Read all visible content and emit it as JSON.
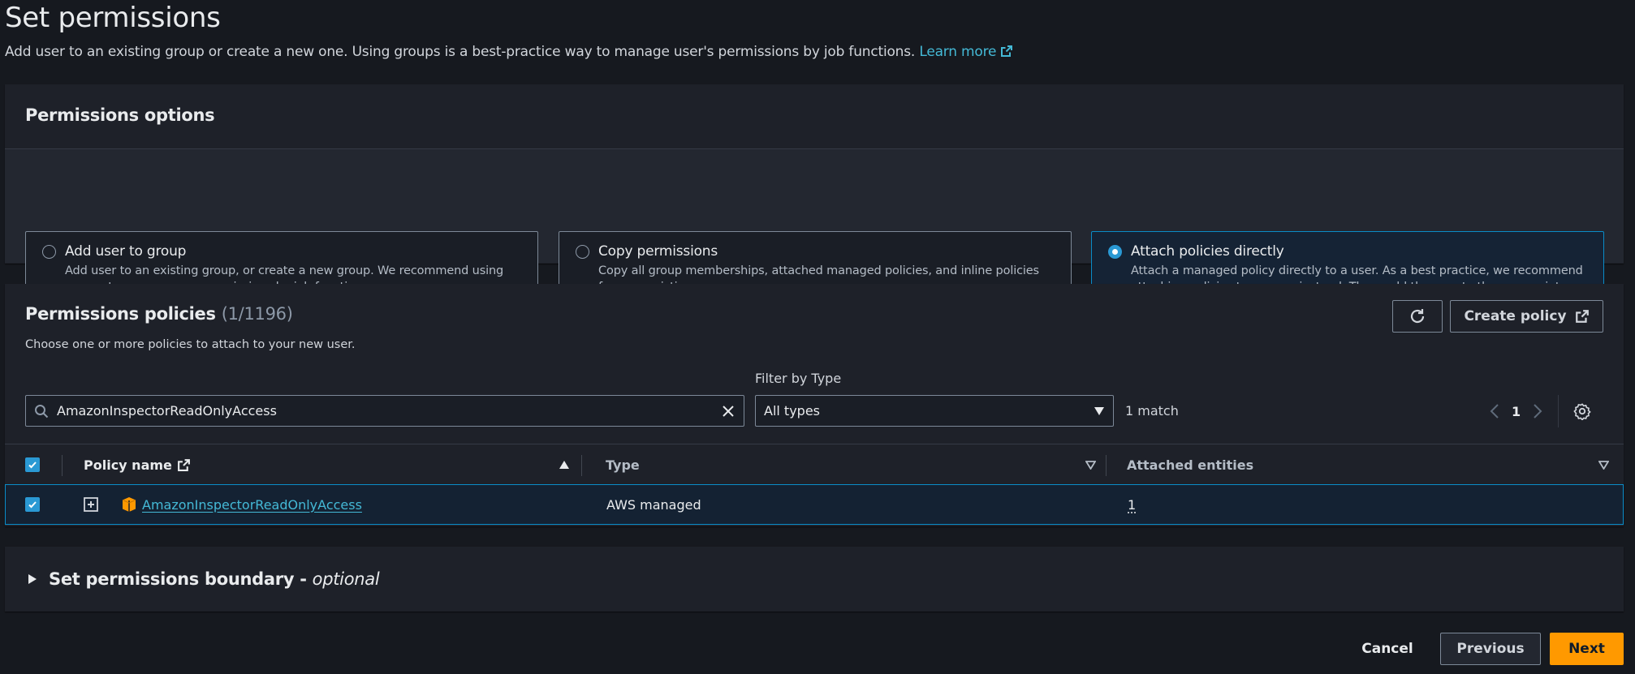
{
  "header": {
    "title": "Set permissions",
    "description": "Add user to an existing group or create a new one. Using groups is a best-practice way to manage user's permissions by job functions.",
    "learn_more": "Learn more"
  },
  "permissions_options": {
    "title": "Permissions options",
    "options": [
      {
        "label": "Add user to group",
        "description": "Add user to an existing group, or create a new group. We recommend using groups to manage user permissions by job function.",
        "selected": false
      },
      {
        "label": "Copy permissions",
        "description": "Copy all group memberships, attached managed policies, and inline policies from an existing user.",
        "selected": false
      },
      {
        "label": "Attach policies directly",
        "description": "Attach a managed policy directly to a user. As a best practice, we recommend attaching policies to a group instead. Then, add the user to the appropriate group.",
        "selected": true
      }
    ]
  },
  "permissions_policies": {
    "title": "Permissions policies",
    "counter": "(1/1196)",
    "description": "Choose one or more policies to attach to your new user.",
    "create_policy": "Create policy",
    "search_value": "AmazonInspectorReadOnlyAccess",
    "filter_label": "Filter by Type",
    "filter_value": "All types",
    "match_count": "1 match",
    "current_page": "1",
    "columns": {
      "policy_name": "Policy name",
      "type": "Type",
      "attached_entities": "Attached entities"
    },
    "rows": [
      {
        "policy_name": "AmazonInspectorReadOnlyAccess",
        "type": "AWS managed",
        "attached_entities": "1",
        "selected": true
      }
    ]
  },
  "boundary": {
    "title": "Set permissions boundary - ",
    "optional": "optional"
  },
  "footer": {
    "cancel": "Cancel",
    "previous": "Previous",
    "next": "Next"
  },
  "colors": {
    "accent": "#44b9d6",
    "primary_button": "#ff9900",
    "selected_border": "#0a8cc8"
  }
}
